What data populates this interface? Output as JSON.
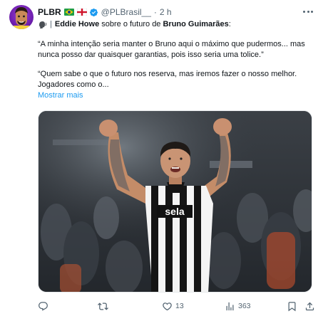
{
  "tweet": {
    "display_name": "PLBR",
    "handle": "@PLBrasil__",
    "separator": "·",
    "time": "2 h",
    "intro_subject": "Eddie Howe",
    "intro_mid": " sobre o futuro de ",
    "intro_object": "Bruno Guimarães",
    "intro_end": ":",
    "quote1": "“A minha intenção seria manter o Bruno aqui o máximo que pudermos... mas nunca posso dar quaisquer garantias, pois isso seria uma tolice.”",
    "quote2": "“Quem sabe o que o futuro nos reserva, mas iremos fazer o nosso melhor. Jogadores como o...",
    "show_more": "Mostrar mais",
    "media": {
      "shirt_sponsor": "sela",
      "description_icon": "player-celebration-photo"
    },
    "actions": {
      "reply_count": "",
      "retweet_count": "",
      "like_count": "13",
      "views_count": "363"
    }
  },
  "icons": {
    "verified": "verified-badge-icon",
    "speaker": "speaking-head-icon",
    "flag_brazil": "brazil-flag-icon",
    "flag_england": "england-flag-icon"
  },
  "colors": {
    "accent": "#1d9bf0",
    "muted": "#536471",
    "text": "#0f1419",
    "avatar_bg": "#7b24b8"
  }
}
